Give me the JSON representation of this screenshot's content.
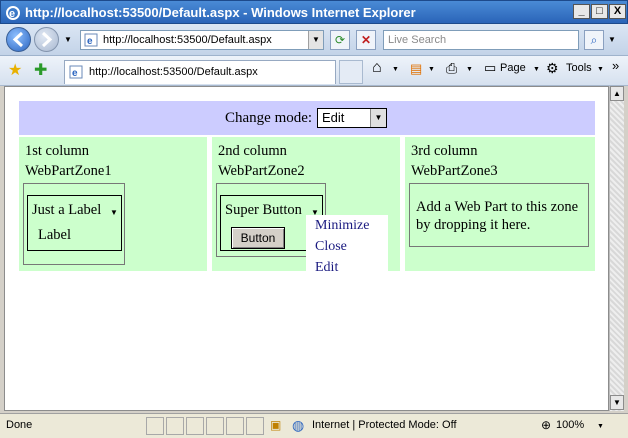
{
  "window": {
    "title": "http://localhost:53500/Default.aspx - Windows Internet Explorer",
    "minimize_glyph": "_",
    "maximize_glyph": "□",
    "close_glyph": "X"
  },
  "toolbar": {
    "address": "http://localhost:53500/Default.aspx",
    "search_placeholder": "Live Search"
  },
  "tab": {
    "title": "http://localhost:53500/Default.aspx"
  },
  "commands": {
    "page_label": "Page",
    "tools_label": "Tools",
    "more": "»"
  },
  "page": {
    "mode_label": "Change mode:",
    "mode_value": "Edit",
    "columns": [
      {
        "heading": "1st column",
        "zone": "WebPartZone1",
        "part_title": "Just a Label",
        "part_content": "Label"
      },
      {
        "heading": "2nd column",
        "zone": "WebPartZone2",
        "part_title": "Super Button",
        "button_label": "Button"
      },
      {
        "heading": "3rd column",
        "zone": "WebPartZone3",
        "empty_text": "Add a Web Part to this zone by dropping it here."
      }
    ],
    "verbs_menu": [
      "Minimize",
      "Close",
      "Edit"
    ]
  },
  "status": {
    "text": "Done",
    "zone": "Internet | Protected Mode: Off",
    "zoom": "100%"
  },
  "colors": {
    "mode_bar": "#ccccff",
    "column_bg": "#ccffcc",
    "verb_link": "#1a1a80"
  }
}
